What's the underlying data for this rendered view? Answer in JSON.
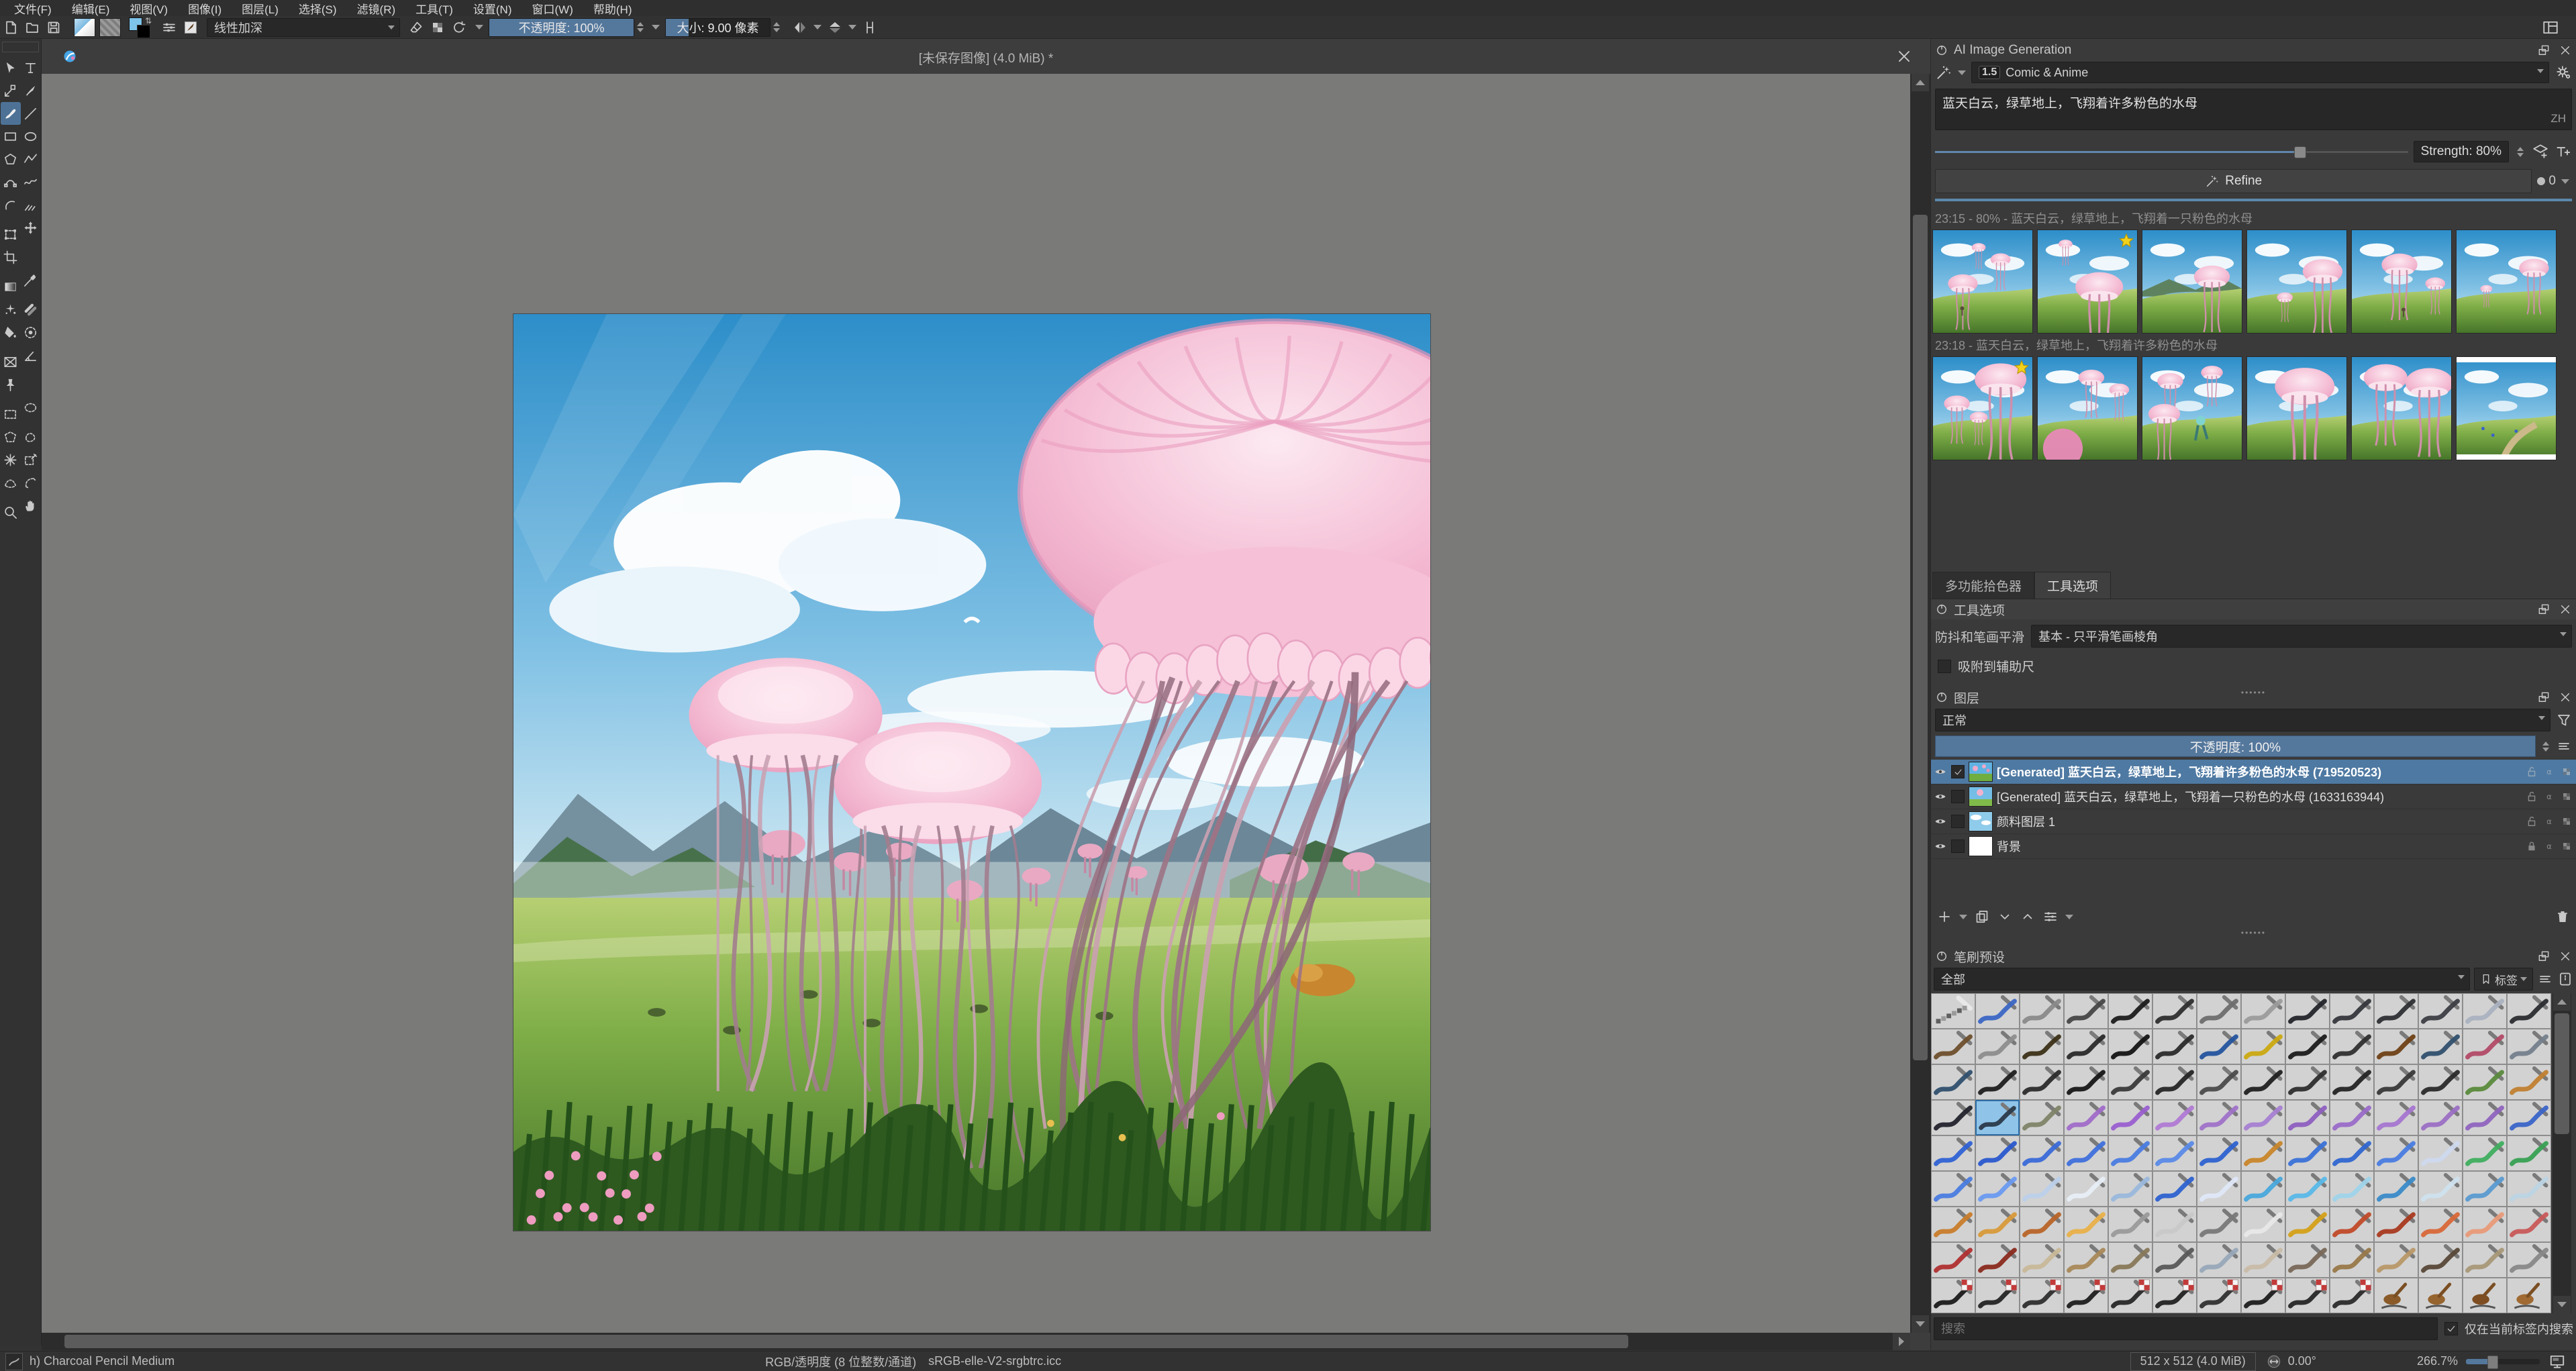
{
  "window": {
    "canvas_title": "[未保存图像] (4.0 MiB) *"
  },
  "menu": {
    "items": [
      "文件(F)",
      "编辑(E)",
      "视图(V)",
      "图像(I)",
      "图层(L)",
      "选择(S)",
      "滤镜(R)",
      "工具(T)",
      "设置(N)",
      "窗口(W)",
      "帮助(H)"
    ]
  },
  "toolbar": {
    "blend_mode": "线性加深",
    "opacity_label": "不透明度:  100%",
    "size_label": "大小:  9.00 像素"
  },
  "toolbox": {
    "selected": "freehand-brush",
    "tools": [
      "select-shapes",
      "text",
      "edit-shapes",
      "calligraphy",
      "freehand-brush",
      "line",
      "rectangle",
      "ellipse",
      "polygon",
      "polyline",
      "bezier-curve",
      "freehand-path",
      "dynamic-brush",
      "multibrush",
      "transform",
      "move",
      "crop",
      null,
      "gradient",
      "color-sampler",
      "colorize-mask",
      "smart-patch",
      "fill",
      "enclose-fill",
      "assistants",
      "measure",
      "reference-images",
      null,
      "select-rectangular",
      "select-elliptical",
      "select-polygonal",
      "select-freehand",
      "select-contiguous",
      "select-similar",
      "select-bezier",
      "select-magnetic",
      "zoom",
      "pan"
    ]
  },
  "ai": {
    "title": "AI Image Generation",
    "style_badge": "1.5",
    "style": "Comic & Anime",
    "prompt": "蓝天白云，绿草地上，飞翔着许多粉色的水母",
    "lang": "ZH",
    "strength": "Strength: 80%",
    "refine": "Refine",
    "queue": "0"
  },
  "history": {
    "groups": [
      {
        "label": "23:15 - 80% - 蓝天白云，绿草地上，飞翔着一只粉色的水母",
        "thumbs": [
          {
            "variant": "A",
            "starred": false
          },
          {
            "variant": "B",
            "starred": true
          },
          {
            "variant": "C",
            "starred": false
          },
          {
            "variant": "D",
            "starred": false
          },
          {
            "variant": "E",
            "starred": false
          },
          {
            "variant": "F",
            "starred": false
          }
        ]
      },
      {
        "label": "23:18 - 蓝天白云，绿草地上，飞翔着许多粉色的水母",
        "thumbs": [
          {
            "variant": "G",
            "starred": true
          },
          {
            "variant": "H",
            "starred": false
          },
          {
            "variant": "I",
            "starred": false
          },
          {
            "variant": "J",
            "starred": false
          },
          {
            "variant": "K",
            "starred": false
          },
          {
            "variant": "L",
            "starred": false,
            "loading": true
          }
        ]
      }
    ]
  },
  "tabs": {
    "picker": "多功能拾色器",
    "tool_options": "工具选项"
  },
  "tool_options": {
    "title": "工具选项",
    "smoothing_label": "防抖和笔画平滑",
    "smoothing_value": "基本 - 只平滑笔画棱角",
    "snap_assistants": "吸附到辅助尺"
  },
  "layers": {
    "title": "图层",
    "blend_mode": "正常",
    "opacity": "不透明度:  100%",
    "rows": [
      {
        "name": "[Generated] 蓝天白云，绿草地上，飞翔着许多粉色的水母 (719520523)",
        "selected": true,
        "checked": true,
        "thumb": "scene1",
        "locked": false
      },
      {
        "name": "[Generated] 蓝天白云，绿草地上，飞翔着一只粉色的水母 (1633163944)",
        "selected": false,
        "checked": false,
        "thumb": "scene2",
        "locked": false
      },
      {
        "name": "颜料图层 1",
        "selected": false,
        "checked": false,
        "thumb": "sky",
        "locked": false
      },
      {
        "name": "背景",
        "selected": false,
        "checked": false,
        "thumb": "white",
        "locked": true
      }
    ]
  },
  "brushes": {
    "title": "笔刷预设",
    "filter_all": "全部",
    "tag_label": "标签",
    "search_placeholder": "搜索",
    "search_scope": "仅在当前标签内搜索",
    "grid": {
      "cols": 14,
      "selected": [
        3,
        1
      ],
      "badge_row": 8,
      "badge_cols": [
        0,
        1,
        2,
        3,
        4,
        5,
        6,
        7,
        8,
        9
      ],
      "stamp_cols": [
        10,
        11,
        12,
        13
      ],
      "rows": [
        {
          "colors": [
            "checker",
            "#3b66c4",
            "#8a8a8a",
            "#474747",
            "#1c1c1c",
            "#2e2e2e",
            "#6e6e6e",
            "#9b9b9b",
            "#23252a",
            "#35373c",
            "#2d2f34",
            "#3c3e44",
            "#aab2c0",
            "#2a2c30"
          ]
        },
        {
          "colors": [
            "#6e4f2c",
            "#8d8d8d",
            "#3c3118",
            "#2a2a2a",
            "#141414",
            "#2b2b2b",
            "#24549e",
            "#caa911",
            "#1b1b1b",
            "#2f2f2f",
            "#6f4116",
            "#30506e",
            "#b24a67",
            "#74808c"
          ]
        },
        {
          "colors": [
            "#30506e",
            "#1f1f1f",
            "#2b2b2b",
            "#171717",
            "#3a3a3a",
            "#262626",
            "#4b4b4b",
            "#202020",
            "#2e2e2e",
            "#242424",
            "#383838",
            "#2a2a2a",
            "#5a8a3c",
            "#c08030"
          ]
        },
        {
          "colors": [
            "#23232e",
            "#2b3a4a",
            "#7e8468",
            "#a06cc8",
            "#9a5fd0",
            "#b07ad4",
            "#9f72c8",
            "#a77fd2",
            "#8e5fc0",
            "#9a6cc8",
            "#a575d0",
            "#9b6fc4",
            "#8f64bf",
            "#3a64c8"
          ]
        },
        {
          "colors": [
            "#2f62d4",
            "#2a58ce",
            "#3a6ad8",
            "#3f70dc",
            "#4a7ce0",
            "#5a8ae8",
            "#2d62d0",
            "#c8862a",
            "#3a72d8",
            "#2f66d0",
            "#4a7ce0",
            "#cdd9ee",
            "#3fae5f",
            "#37a052"
          ]
        },
        {
          "colors": [
            "#4a7ce0",
            "#6a9af0",
            "#bcd0ea",
            "#e8eef6",
            "#9ab8dc",
            "#2d62d0",
            "#dfe8f8",
            "#49a8dc",
            "#58b8e8",
            "#9fd4ea",
            "#3a8ac8",
            "#cfe2ee",
            "#5a9ad0",
            "#bcd4e4"
          ]
        },
        {
          "colors": [
            "#c87c2a",
            "#d89a3a",
            "#b86428",
            "#e8b048",
            "#9a9a9a",
            "#c8c8c8",
            "#787878",
            "#e8e8e8",
            "#d4a018",
            "#c04a28",
            "#a83a20",
            "#d86838",
            "#e89a78",
            "#c85858"
          ]
        },
        {
          "colors": [
            "#b03030",
            "#8a2a1e",
            "#c8b898",
            "#a88858",
            "#887858",
            "#585858",
            "#98a8b8",
            "#c8bca8",
            "#786858",
            "#987848",
            "#b89868",
            "#584838",
            "#a89878",
            "#888888"
          ]
        },
        {
          "colors": [
            "#1a1a1a",
            "#242424",
            "#2e2e2e",
            "#1e1e1e",
            "#282828",
            "#222222",
            "#303030",
            "#1c1c1c",
            "#262626",
            "#2a2a2a",
            "#8a5a28",
            "#96642e",
            "#7e4e22",
            "#a06a32"
          ]
        }
      ]
    }
  },
  "status": {
    "brush_name": "h) Charcoal Pencil Medium",
    "color_info": "RGB/透明度 (8 位整数/通道)",
    "icc": "sRGB-elle-V2-srgbtrc.icc",
    "doc_size": "512 x 512 (4.0 MiB)",
    "rotation": "0.00°",
    "zoom": "266.7%"
  },
  "colors": {
    "accent_fill": "#54779c",
    "selection_blue": "#4e79a2",
    "star_yellow": "#f2d21c",
    "canvas_gray": "#7a7a79"
  }
}
